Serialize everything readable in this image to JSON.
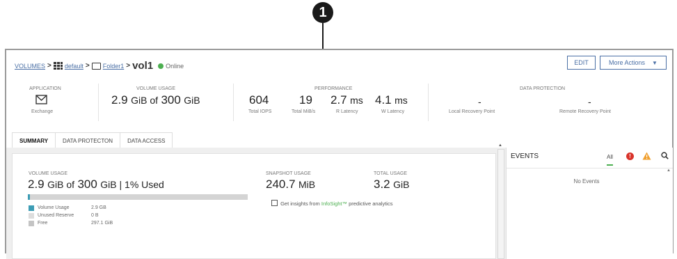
{
  "callout": {
    "number": "1"
  },
  "breadcrumb": {
    "volumes": "VOLUMES",
    "sep": ">",
    "pool": "default",
    "folder": "Folder1",
    "volume": "vol1",
    "status": "Online"
  },
  "buttons": {
    "edit": "EDIT",
    "more_actions": "More Actions",
    "more_actions_arrow": "▼"
  },
  "summary": {
    "application": {
      "label": "APPLICATION",
      "value": "Exchange"
    },
    "volume_usage": {
      "label": "VOLUME USAGE",
      "used": "2.9",
      "used_unit": "GiB of",
      "total": "300",
      "total_unit": "GiB"
    },
    "performance": {
      "label": "PERFORMANCE",
      "iops": {
        "value": "604",
        "label": "Total IOPS"
      },
      "mibs": {
        "value": "19",
        "label": "Total MiB/s"
      },
      "r_latency": {
        "value": "2.7",
        "unit": "ms",
        "label": "R Latency"
      },
      "w_latency": {
        "value": "4.1",
        "unit": "ms",
        "label": "W Latency"
      }
    },
    "data_protection": {
      "label": "DATA PROTECTION",
      "local": {
        "value": "-",
        "label": "Local Recovery Point"
      },
      "remote": {
        "value": "-",
        "label": "Remote Recovery Point"
      }
    }
  },
  "tabs": [
    "SUMMARY",
    "DATA PROTECTON",
    "DATA ACCESS"
  ],
  "card": {
    "volume_usage_label": "VOLUME USAGE",
    "volume_usage_used": "2.9",
    "volume_usage_used_unit": "GiB of",
    "volume_usage_total": "300",
    "volume_usage_total_unit": "GiB | 1% Used",
    "usage_fraction": 0.01,
    "legend": [
      {
        "name": "Volume Usage",
        "value": "2.9 GB",
        "color": "#3d9db5"
      },
      {
        "name": "Unused Reserve",
        "value": "0 B",
        "color": "#dddddd"
      },
      {
        "name": "Free",
        "value": "297.1 GiB",
        "color": "#c4c4c4"
      }
    ],
    "snapshot_label": "SNAPSHOT USAGE",
    "snapshot_value": "240.7",
    "snapshot_unit": "MiB",
    "total_label": "TOTAL USAGE",
    "total_value": "3.2",
    "total_unit": "GiB",
    "insight_prefix": "Get insights from",
    "insight_brand": "InfoSight™",
    "insight_suffix": "predictive analytics"
  },
  "events": {
    "title": "EVENTS",
    "filter_all": "All",
    "error_icon": "!",
    "warning_icon": "!",
    "empty": "No Events"
  },
  "colors": {
    "accent": "#4a6fa5",
    "online": "#4caf50",
    "error": "#d9342b",
    "warning": "#f0a030",
    "insight": "#4caf50"
  }
}
